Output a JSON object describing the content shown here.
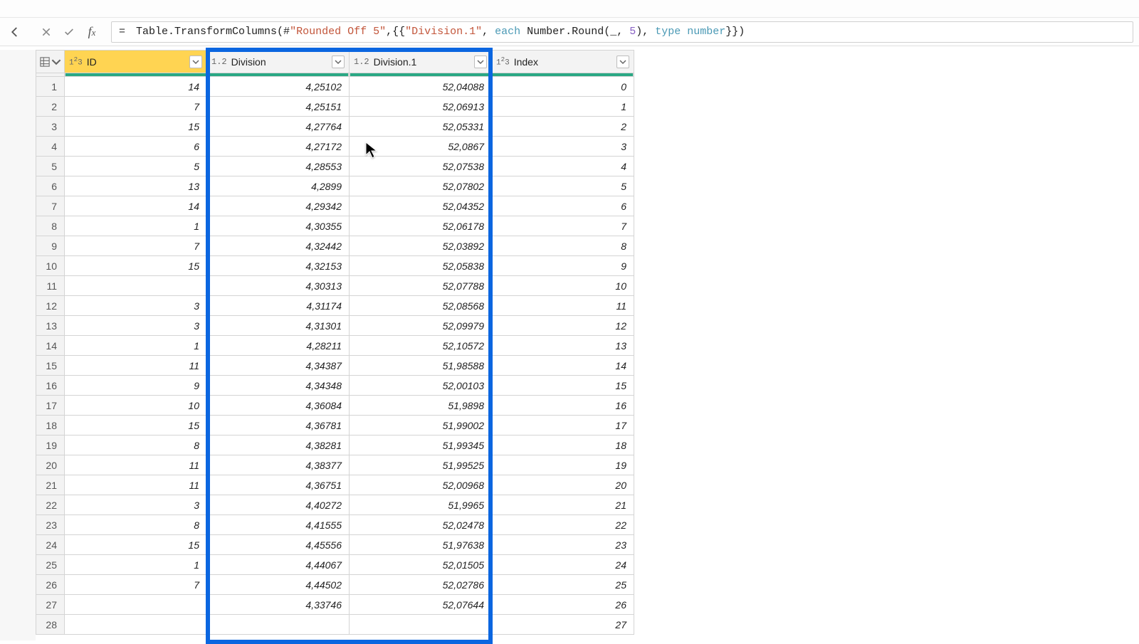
{
  "formula": {
    "raw": "= Table.TransformColumns(#\"Rounded Off 5\",{{\"Division.1\", each Number.Round(_, 5), type number}})",
    "prefix": "= ",
    "p1": "Table.TransformColumns(#",
    "str1": "\"Rounded Off 5\"",
    "p2": ",{{",
    "str2": "\"Division.1\"",
    "p3": ", ",
    "kw_each": "each",
    "p4": " Number.Round(_, ",
    "num5": "5",
    "p5": "), ",
    "kw_type": "type",
    "p6": " ",
    "kw_number": "number",
    "p7": "}})"
  },
  "columns": {
    "id": {
      "type": "1²3",
      "label": "ID"
    },
    "division": {
      "type": "1.2",
      "label": "Division"
    },
    "division1": {
      "type": "1.2",
      "label": "Division.1"
    },
    "index": {
      "type": "1²3",
      "label": "Index"
    }
  },
  "rows": [
    {
      "n": "1",
      "id": "14",
      "div": "4,25102",
      "div1": "52,04088",
      "idx": "0"
    },
    {
      "n": "2",
      "id": "7",
      "div": "4,25151",
      "div1": "52,06913",
      "idx": "1"
    },
    {
      "n": "3",
      "id": "15",
      "div": "4,27764",
      "div1": "52,05331",
      "idx": "2"
    },
    {
      "n": "4",
      "id": "6",
      "div": "4,27172",
      "div1": "52,0867",
      "idx": "3"
    },
    {
      "n": "5",
      "id": "5",
      "div": "4,28553",
      "div1": "52,07538",
      "idx": "4"
    },
    {
      "n": "6",
      "id": "13",
      "div": "4,2899",
      "div1": "52,07802",
      "idx": "5"
    },
    {
      "n": "7",
      "id": "14",
      "div": "4,29342",
      "div1": "52,04352",
      "idx": "6"
    },
    {
      "n": "8",
      "id": "1",
      "div": "4,30355",
      "div1": "52,06178",
      "idx": "7"
    },
    {
      "n": "9",
      "id": "7",
      "div": "4,32442",
      "div1": "52,03892",
      "idx": "8"
    },
    {
      "n": "10",
      "id": "15",
      "div": "4,32153",
      "div1": "52,05838",
      "idx": "9"
    },
    {
      "n": "11",
      "id": "",
      "div": "4,30313",
      "div1": "52,07788",
      "idx": "10"
    },
    {
      "n": "12",
      "id": "3",
      "div": "4,31174",
      "div1": "52,08568",
      "idx": "11"
    },
    {
      "n": "13",
      "id": "3",
      "div": "4,31301",
      "div1": "52,09979",
      "idx": "12"
    },
    {
      "n": "14",
      "id": "1",
      "div": "4,28211",
      "div1": "52,10572",
      "idx": "13"
    },
    {
      "n": "15",
      "id": "11",
      "div": "4,34387",
      "div1": "51,98588",
      "idx": "14"
    },
    {
      "n": "16",
      "id": "9",
      "div": "4,34348",
      "div1": "52,00103",
      "idx": "15"
    },
    {
      "n": "17",
      "id": "10",
      "div": "4,36084",
      "div1": "51,9898",
      "idx": "16"
    },
    {
      "n": "18",
      "id": "15",
      "div": "4,36781",
      "div1": "51,99002",
      "idx": "17"
    },
    {
      "n": "19",
      "id": "8",
      "div": "4,38281",
      "div1": "51,99345",
      "idx": "18"
    },
    {
      "n": "20",
      "id": "11",
      "div": "4,38377",
      "div1": "51,99525",
      "idx": "19"
    },
    {
      "n": "21",
      "id": "11",
      "div": "4,36751",
      "div1": "52,00968",
      "idx": "20"
    },
    {
      "n": "22",
      "id": "3",
      "div": "4,40272",
      "div1": "51,9965",
      "idx": "21"
    },
    {
      "n": "23",
      "id": "8",
      "div": "4,41555",
      "div1": "52,02478",
      "idx": "22"
    },
    {
      "n": "24",
      "id": "15",
      "div": "4,45556",
      "div1": "51,97638",
      "idx": "23"
    },
    {
      "n": "25",
      "id": "1",
      "div": "4,44067",
      "div1": "52,01505",
      "idx": "24"
    },
    {
      "n": "26",
      "id": "7",
      "div": "4,44502",
      "div1": "52,02786",
      "idx": "25"
    },
    {
      "n": "27",
      "id": "",
      "div": "4,33746",
      "div1": "52,07644",
      "idx": "26"
    },
    {
      "n": "28",
      "id": "",
      "div": "",
      "div1": "",
      "idx": "27"
    }
  ]
}
